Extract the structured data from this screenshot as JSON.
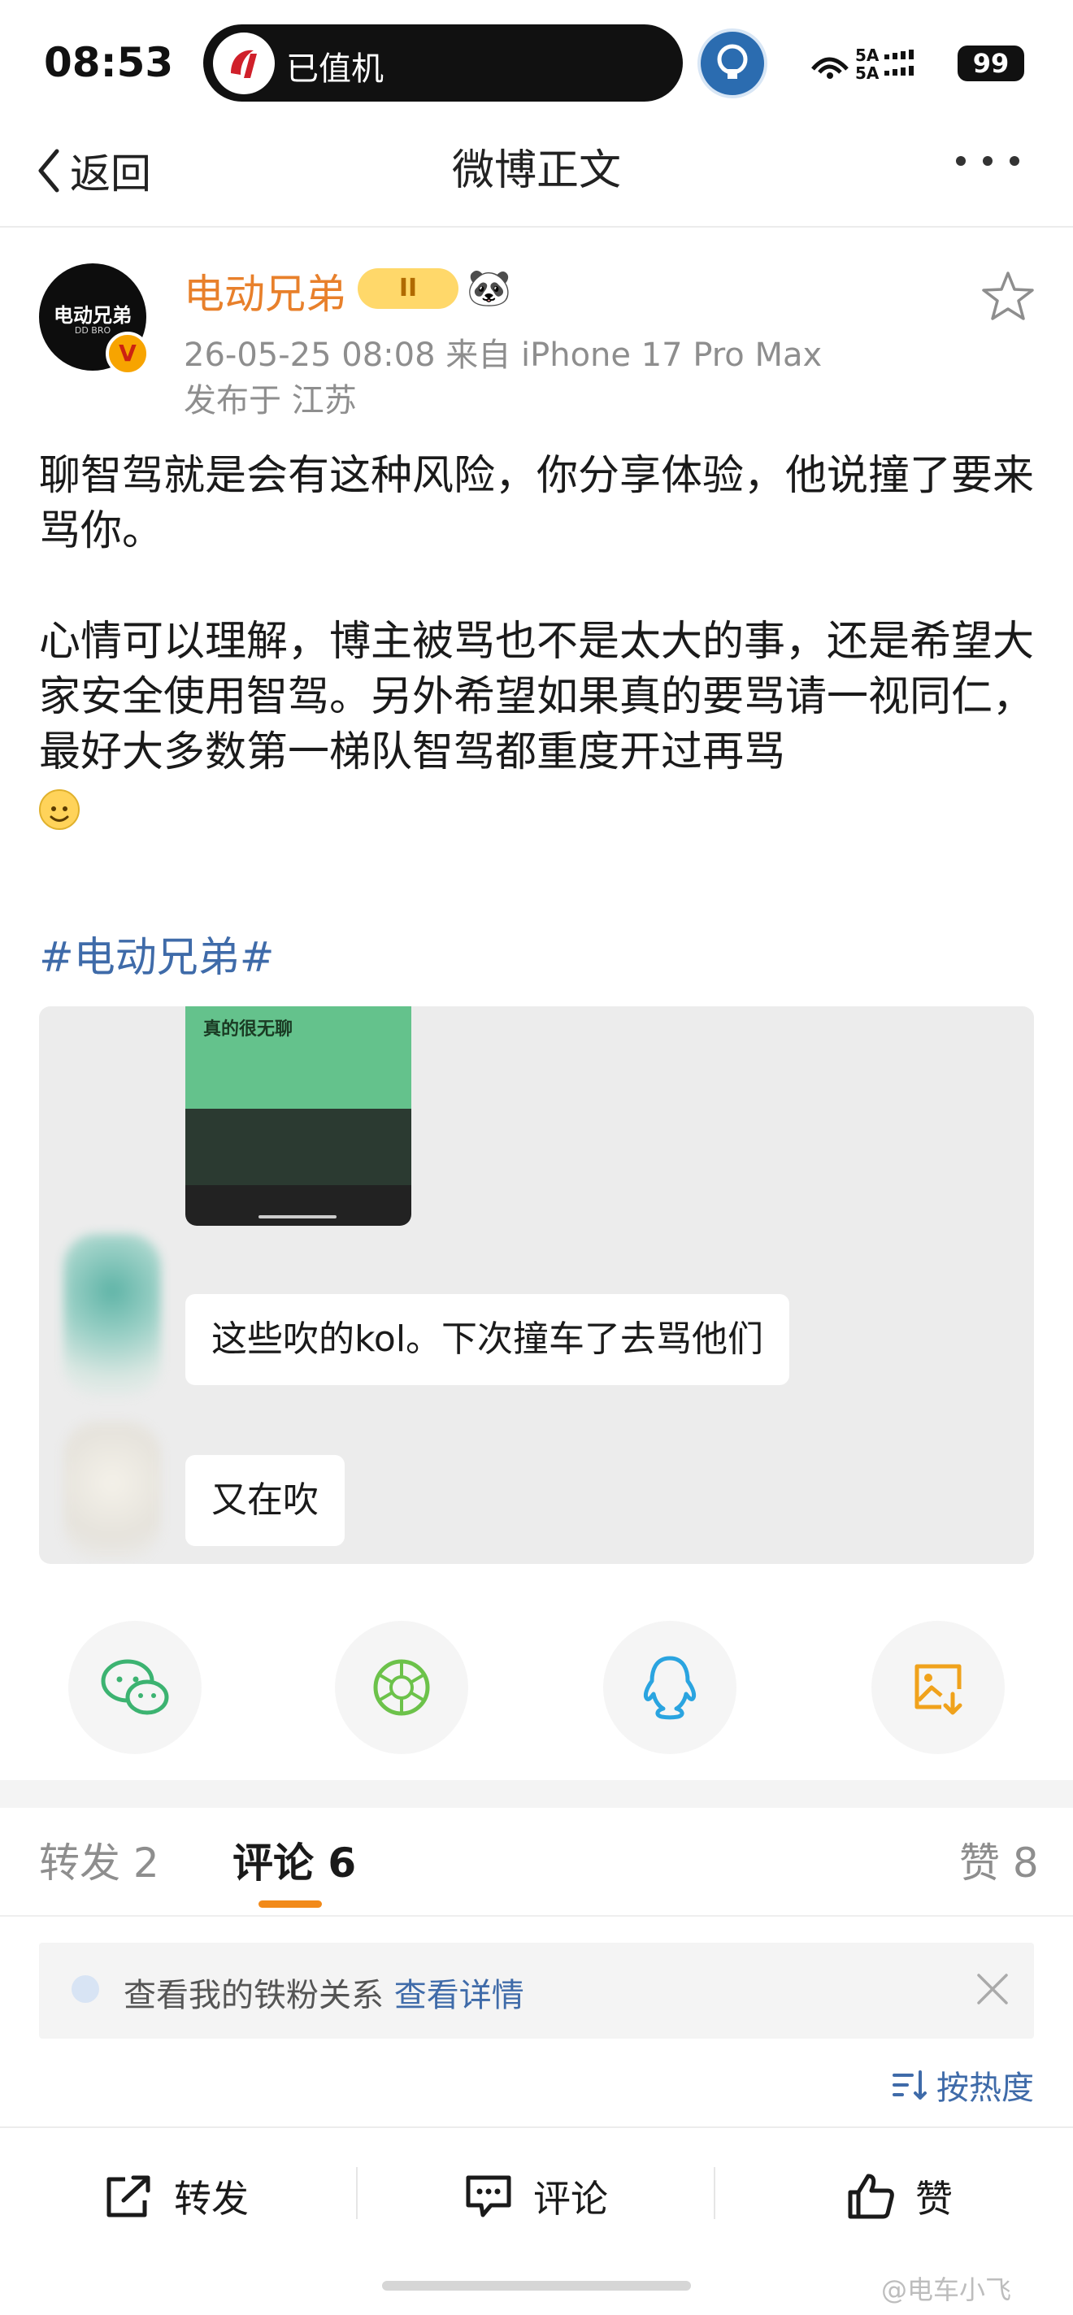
{
  "status_bar": {
    "time": "08:53",
    "pill_text": "已值机",
    "signal_text": "5A 5A",
    "battery": "99"
  },
  "nav": {
    "back_label": "返回",
    "title": "微博正文"
  },
  "post": {
    "avatar_text": "电动兄弟",
    "avatar_sub": "DD BRO",
    "author": "电动兄弟",
    "vip_badge": "II",
    "meta": "26-05-25 08:08  来自 iPhone 17 Pro Max",
    "location": "发布于 江苏",
    "paragraphs": [
      "聊智驾就是会有这种风险，你分享体验，他说撞了要来骂你。",
      "心情可以理解，博主被骂也不是太大的事，还是希望大家安全使用智驾。另外希望如果真的要骂请一视同仁，最好大多数第一梯队智驾都重度开过再骂"
    ],
    "hashtag": "#电动兄弟#"
  },
  "image": {
    "phone_label": "真的很无聊",
    "bubble1": "这些吹的kol。下次撞车了去骂他们",
    "bubble2": "又在吹"
  },
  "share_icons": [
    "wechat-icon",
    "moments-icon",
    "qq-icon",
    "save-image-icon"
  ],
  "stats": {
    "repost": "转发 2",
    "comment": "评论 6",
    "like": "赞 8"
  },
  "notice": {
    "text": "查看我的铁粉关系",
    "link": "查看详情"
  },
  "sort": {
    "label": "按热度"
  },
  "actions": {
    "repost": "转发",
    "comment": "评论",
    "like": "赞"
  },
  "watermark": "@电车小飞",
  "colors": {
    "author": "#e8802b",
    "link": "#3f6ba9",
    "tab_accent": "#f28a1a",
    "wechat": "#3cb371",
    "moments": "#6cc24a",
    "qq": "#2aa4e0",
    "save": "#f0a21c"
  }
}
